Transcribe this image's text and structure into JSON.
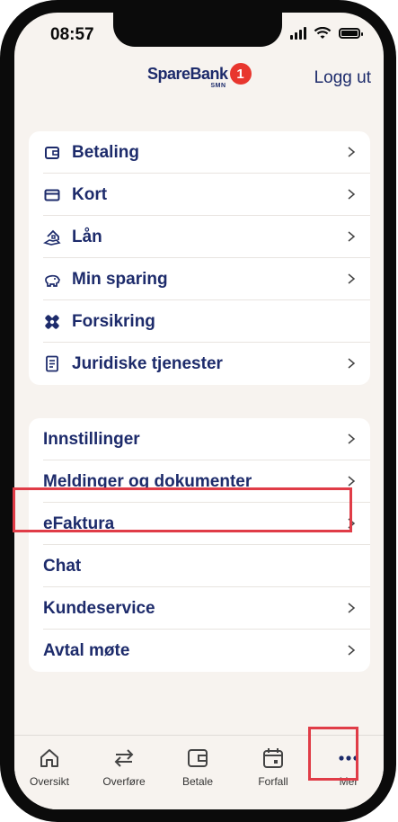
{
  "status": {
    "time": "08:57"
  },
  "header": {
    "brand": "SpareBank",
    "brand_sub": "SMN",
    "brand_number": "1",
    "logout": "Logg ut"
  },
  "menu1": [
    {
      "label": "Betaling",
      "icon": "wallet-icon",
      "chevron": true
    },
    {
      "label": "Kort",
      "icon": "card-icon",
      "chevron": true
    },
    {
      "label": "Lån",
      "icon": "house-hand-icon",
      "chevron": true
    },
    {
      "label": "Min sparing",
      "icon": "piggy-bank-icon",
      "chevron": true
    },
    {
      "label": "Forsikring",
      "icon": "bandage-icon",
      "chevron": false
    },
    {
      "label": "Juridiske tjenester",
      "icon": "document-icon",
      "chevron": true
    }
  ],
  "menu2": [
    {
      "label": "Innstillinger",
      "chevron": true
    },
    {
      "label": "Meldinger og dokumenter",
      "chevron": true
    },
    {
      "label": "eFaktura",
      "chevron": true
    },
    {
      "label": "Chat",
      "chevron": false
    },
    {
      "label": "Kundeservice",
      "chevron": true
    },
    {
      "label": "Avtal møte",
      "chevron": true
    }
  ],
  "tabs": [
    {
      "label": "Oversikt",
      "icon": "home-icon"
    },
    {
      "label": "Overføre",
      "icon": "transfer-icon"
    },
    {
      "label": "Betale",
      "icon": "wallet-icon"
    },
    {
      "label": "Forfall",
      "icon": "calendar-icon"
    },
    {
      "label": "Mer",
      "icon": "more-icon"
    }
  ],
  "colors": {
    "primary": "#1d2b6b",
    "highlight": "#e03c47",
    "background": "#f7f3ef",
    "brand_red": "#e8362e"
  }
}
